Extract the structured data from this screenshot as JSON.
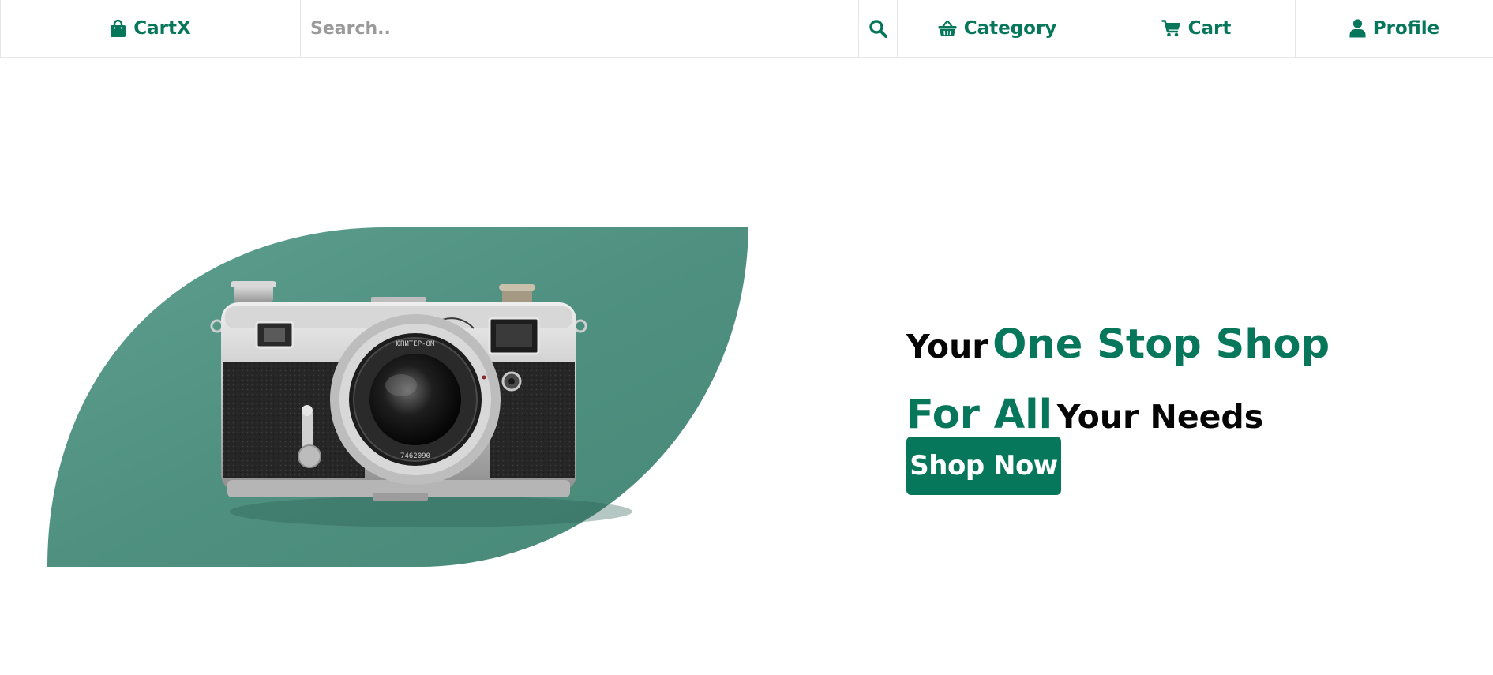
{
  "navbar": {
    "brand": {
      "label": "CartX",
      "icon": "shopping-bag-icon"
    },
    "search": {
      "placeholder": "Search..",
      "value": "",
      "icon": "search-icon"
    },
    "items": [
      {
        "label": "Category",
        "icon": "basket-icon"
      },
      {
        "label": "Cart",
        "icon": "shopping-cart-icon"
      },
      {
        "label": "Profile",
        "icon": "user-icon"
      }
    ]
  },
  "hero": {
    "line1": {
      "part1": "Your",
      "part2": "One Stop Shop"
    },
    "line2": {
      "part1": "For All",
      "part2": "Your Needs"
    },
    "cta_label": "Shop Now",
    "image": "vintage-camera-photo"
  },
  "colors": {
    "accent": "#06775a",
    "leaf": "#4f8f80",
    "text_dark": "#050505",
    "placeholder": "#9a9a9a",
    "border": "#e6e6e6"
  }
}
